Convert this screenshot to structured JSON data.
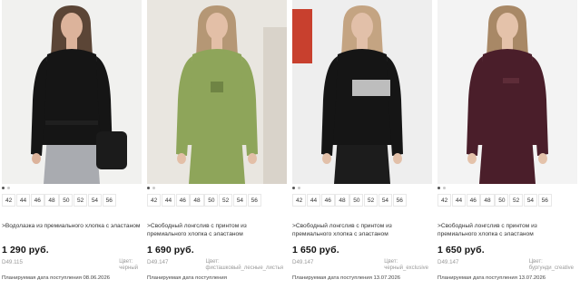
{
  "products": [
    {
      "sizes": [
        "42",
        "44",
        "46",
        "48",
        "50",
        "52",
        "54",
        "56"
      ],
      "title": ">Водолазка из премиального хлопка с эластаном",
      "price": "1 290 руб.",
      "sku": "D49.115",
      "color_label": "Цвет:",
      "color_value": "черный",
      "arrival": "Планируемая дата поступления 08.06.2026",
      "image": {
        "bg": "#f1f1ef",
        "shirt": "#151515",
        "pants": "#a9abb0",
        "hair": "#5b4536",
        "skin": "#dcb39b"
      }
    },
    {
      "sizes": [
        "42",
        "44",
        "46",
        "48",
        "50",
        "52",
        "54",
        "56"
      ],
      "title": ">Свободный лонгслив с принтом из премиального хлопка с эластаном",
      "price": "1 690 руб.",
      "sku": "D49.147",
      "color_label": "Цвет:",
      "color_value": "фисташковый_лесные_листья",
      "arrival": "Планируемая дата поступления",
      "image": {
        "bg": "#e9e6e0",
        "shirt": "#8ea55a",
        "pants": "#8ea55a",
        "hair": "#b59775",
        "skin": "#e3bfa7"
      }
    },
    {
      "sizes": [
        "42",
        "44",
        "46",
        "48",
        "50",
        "52",
        "54",
        "56"
      ],
      "title": ">Свободный лонгслив с принтом из премиального хлопка с эластаном",
      "price": "1 650 руб.",
      "sku": "D49.147",
      "color_label": "Цвет:",
      "color_value": "черный_exclusive",
      "arrival": "Планируемая дата поступления 13.07.2026",
      "image": {
        "bg": "#eeeeee",
        "shirt": "#151515",
        "pants": "#1c1c1c",
        "hair": "#c4a482",
        "skin": "#e2c0a9"
      }
    },
    {
      "sizes": [
        "42",
        "44",
        "46",
        "48",
        "50",
        "52",
        "54",
        "56"
      ],
      "title": ">Свободный лонгслив с принтом из премиального хлопка с эластаном",
      "price": "1 650 руб.",
      "sku": "D49.147",
      "color_label": "Цвет:",
      "color_value": "бургунди_creative",
      "arrival": "Планируемая дата поступления 13.07.2026",
      "image": {
        "bg": "#f3f3f3",
        "shirt": "#4a1e2a",
        "pants": "#4a1e2a",
        "hair": "#a88866",
        "skin": "#e4c2aa"
      }
    }
  ]
}
